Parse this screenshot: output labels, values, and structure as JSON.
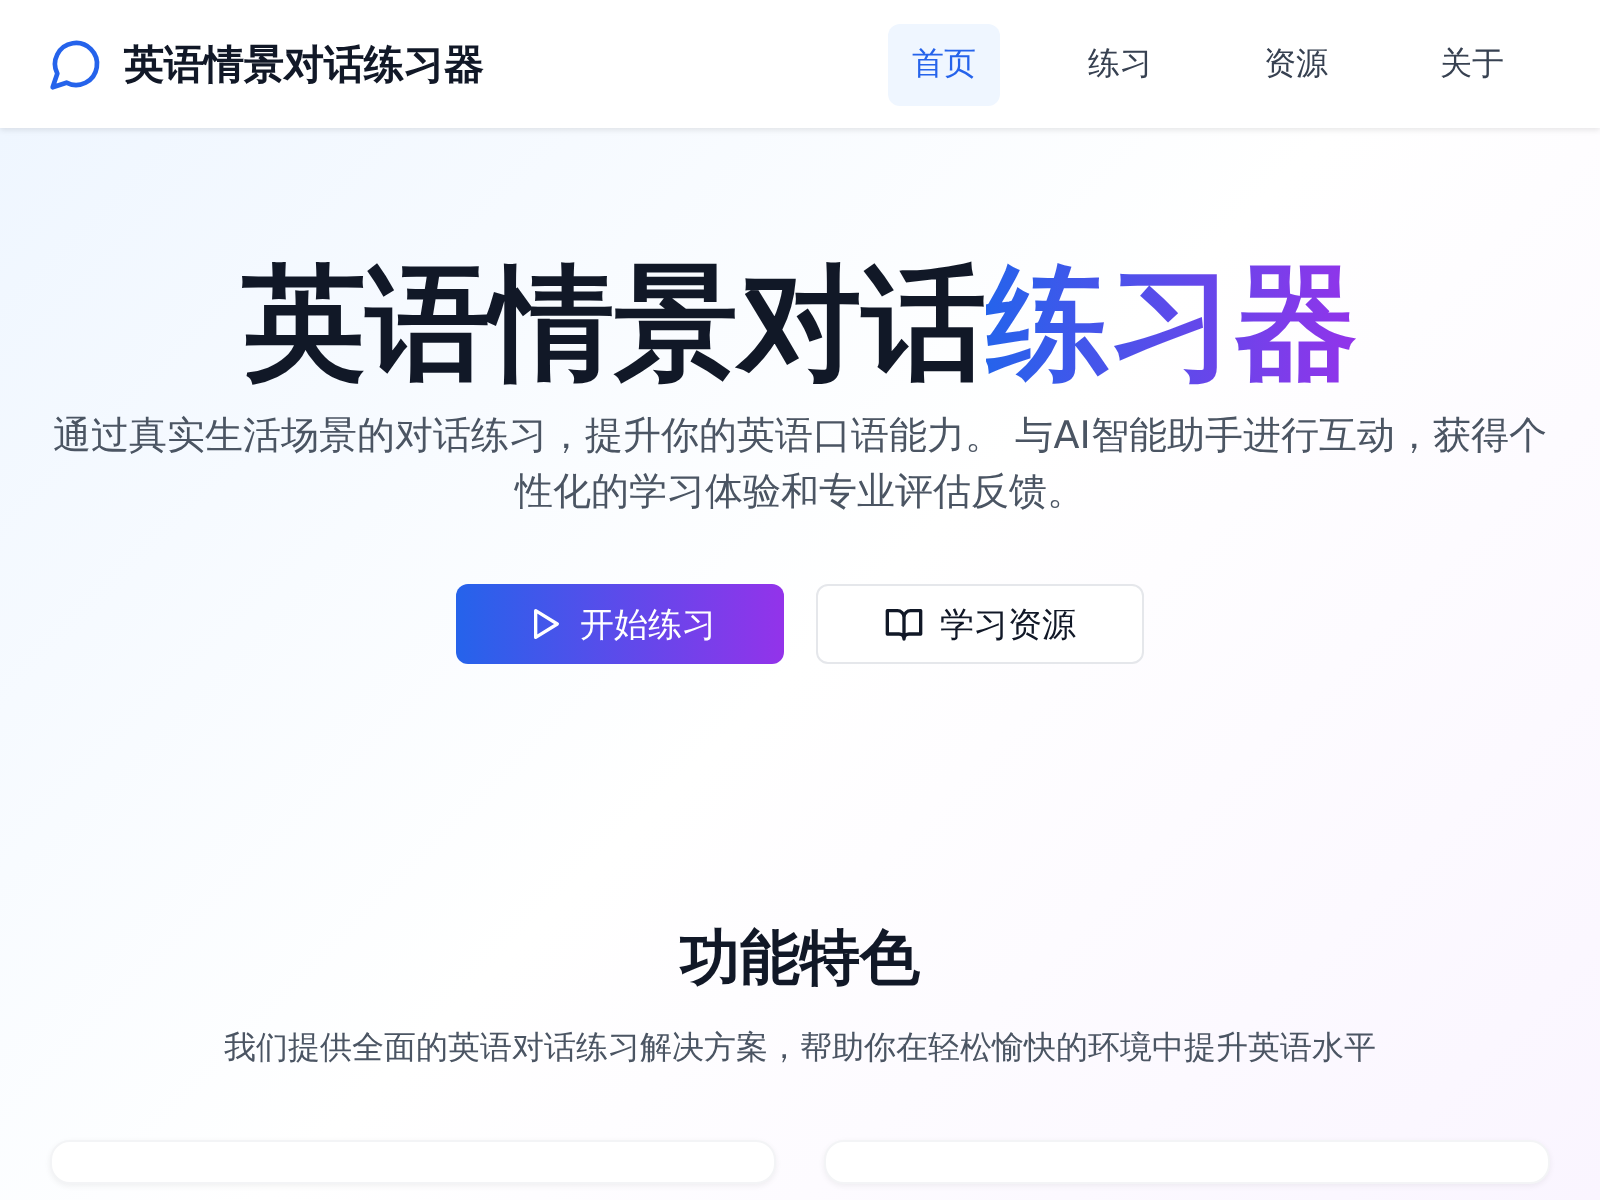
{
  "header": {
    "brand": "英语情景对话练习器",
    "nav": [
      {
        "label": "首页",
        "selected": true
      },
      {
        "label": "练习",
        "selected": false
      },
      {
        "label": "资源",
        "selected": false
      },
      {
        "label": "关于",
        "selected": false
      }
    ]
  },
  "hero": {
    "title": "英语情景对话",
    "title_highlight": "练习器",
    "subtitle": "通过真实生活场景的对话练习，提升你的英语口语能力。 与AI智能助手进行互动，获得个性化的学习体验和专业评估反馈。",
    "buttons": [
      {
        "label": "开始练习",
        "kind": "primary"
      },
      {
        "label": "学习资源",
        "kind": "secondary"
      }
    ]
  },
  "features": {
    "title": "功能特色",
    "subtitle": "我们提供全面的英语对话练习解决方案，帮助你在轻松愉快的环境中提升英语水平",
    "cards": [
      {
        "kind": "feature"
      },
      {
        "kind": "feature"
      }
    ]
  }
}
